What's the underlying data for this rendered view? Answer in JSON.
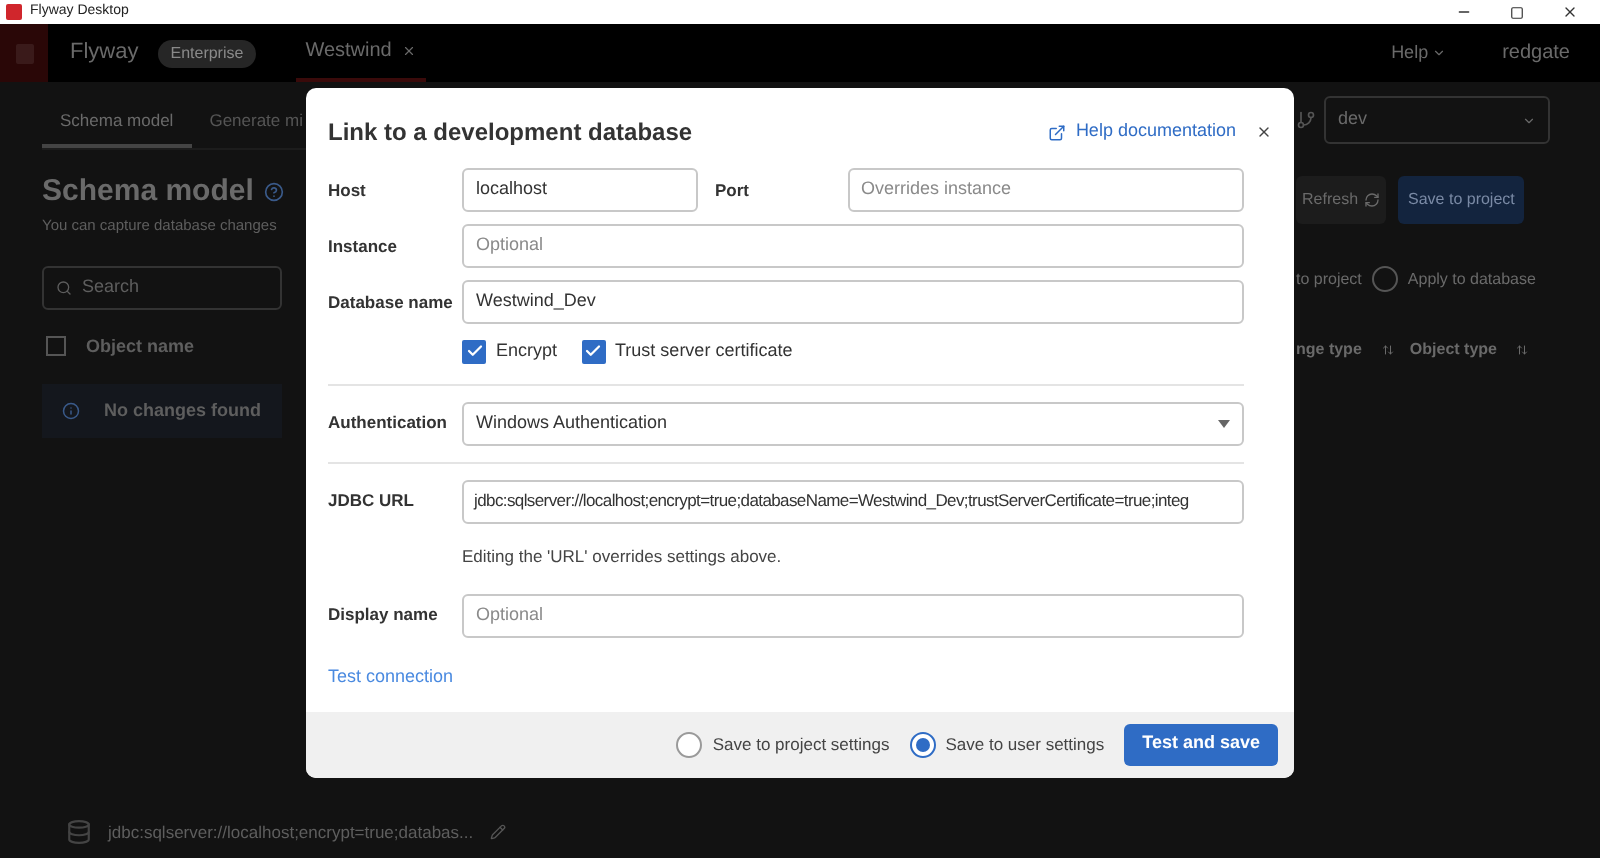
{
  "title_bar": {
    "title": "Flyway Desktop"
  },
  "header": {
    "product": "Flyway",
    "edition": "Enterprise",
    "project_tab": "Westwind",
    "help": "Help",
    "brand": "redgate"
  },
  "subtabs": [
    {
      "label": "Schema model",
      "selected": true
    },
    {
      "label": "Generate mi",
      "selected": false
    }
  ],
  "page": {
    "title": "Schema model",
    "subtitle": "You can capture database changes",
    "search": {
      "placeholder": "Search"
    },
    "object_column": {
      "label": "Object name",
      "checked": false
    },
    "notice": "No changes found",
    "connection": "jdbc:sqlserver://localhost;encrypt=true;databas..."
  },
  "right_panel": {
    "environment": "dev",
    "refresh": "Refresh",
    "save": "Save to project",
    "partial_option": "to project",
    "apply_option": {
      "label": "Apply to database",
      "selected": false
    },
    "columns": [
      "nge type",
      "Object type"
    ]
  },
  "dialog": {
    "title": "Link to a development database",
    "help_link": "Help documentation",
    "host": {
      "label": "Host",
      "value": "localhost"
    },
    "port": {
      "label": "Port",
      "placeholder": "Overrides instance"
    },
    "instance": {
      "label": "Instance",
      "placeholder": "Optional"
    },
    "database_name": {
      "label": "Database name",
      "value": "Westwind_Dev"
    },
    "checkboxes": [
      {
        "label": "Encrypt",
        "checked": true
      },
      {
        "label": "Trust server certificate",
        "checked": true
      }
    ],
    "authentication": {
      "label": "Authentication",
      "value": "Windows Authentication"
    },
    "jdbc_url": {
      "label": "JDBC URL",
      "value": "jdbc:sqlserver://localhost;encrypt=true;databaseName=Westwind_Dev;trustServerCertificate=true;integ",
      "hint": "Editing the 'URL' overrides settings above."
    },
    "display_name": {
      "label": "Display name",
      "placeholder": "Optional"
    },
    "test_link": "Test connection",
    "save_options": [
      {
        "label": "Save to project settings",
        "selected": false
      },
      {
        "label": "Save to user settings",
        "selected": true
      }
    ],
    "primary_button": "Test and save"
  }
}
